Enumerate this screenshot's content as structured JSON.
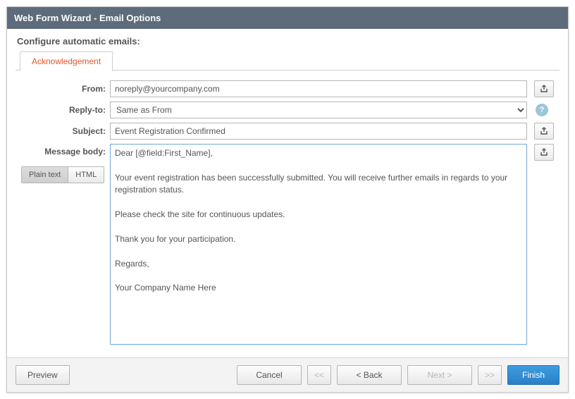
{
  "window": {
    "title": "Web Form Wizard - Email Options"
  },
  "section_heading": "Configure automatic emails:",
  "tab": {
    "acknowledgement": "Acknowledgement"
  },
  "labels": {
    "from": "From:",
    "reply_to": "Reply-to:",
    "subject": "Subject:",
    "message_body": "Message body:"
  },
  "fields": {
    "from": "noreply@yourcompany.com",
    "reply_to_selected": "Same as From",
    "subject": "Event Registration Confirmed",
    "body": "Dear [@field:First_Name],\n\nYour event registration has been successfully submitted. You will receive further emails in regards to your registration status.\n\nPlease check the site for continuous updates.\n\nThank you for your participation.\n\nRegards,\n\nYour Company Name Here"
  },
  "format_toggle": {
    "plain": "Plain text",
    "html": "HTML",
    "active": "plain"
  },
  "help_badge": "?",
  "footer": {
    "preview": "Preview",
    "cancel": "Cancel",
    "first": "<<",
    "back": "< Back",
    "next": "Next >",
    "last": ">>",
    "finish": "Finish"
  }
}
